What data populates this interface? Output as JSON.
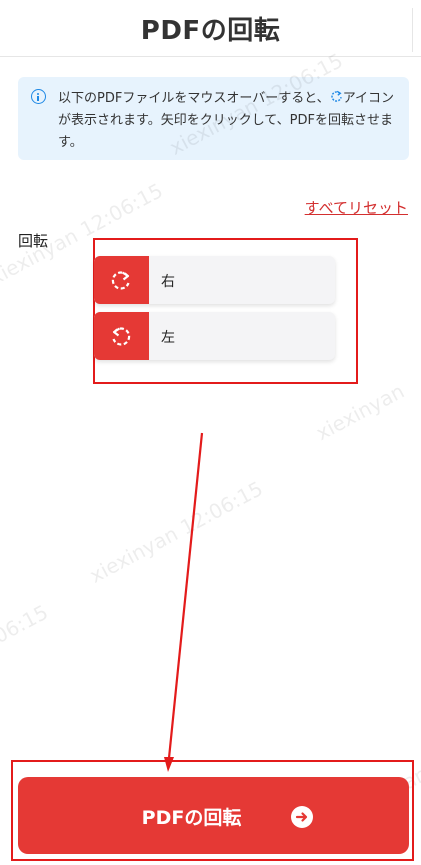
{
  "header": {
    "title": "PDFの回転"
  },
  "info": {
    "text_before_icon": "以下のPDFファイルをマウスオーバーすると、",
    "text_after_icon": "アイコンが表示されます。矢印をクリックして、PDFを回転させます。",
    "icon": "info-icon",
    "inline_icon": "rotate-icon"
  },
  "reset": {
    "label": "すべてリセット"
  },
  "rotation": {
    "label": "回転",
    "options": [
      {
        "label": "右",
        "icon": "rotate-clockwise-icon"
      },
      {
        "label": "左",
        "icon": "rotate-counterclockwise-icon"
      }
    ]
  },
  "cta": {
    "label": "PDFの回転",
    "icon": "arrow-right-circle-icon"
  },
  "watermarks": [
    "xiexinyan 12:06:15",
    "xiexinyan 12:06:15",
    "xiexinyan 12:06:15",
    "xiexinyan 12:06:15",
    "06:15",
    "xiexinyan"
  ],
  "colors": {
    "accent": "#e53935",
    "annotation": "#e31b1b",
    "info_bg": "#e7f3fd",
    "info_icon": "#1e88e5",
    "link": "#d32f2f"
  }
}
